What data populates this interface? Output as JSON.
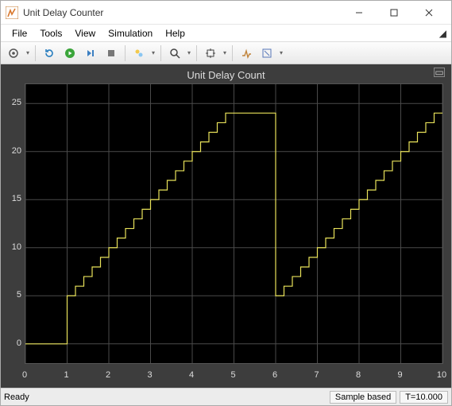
{
  "window": {
    "title": "Unit Delay Counter"
  },
  "menu": {
    "items": [
      "File",
      "Tools",
      "View",
      "Simulation",
      "Help"
    ]
  },
  "toolbar": {
    "buttons": [
      {
        "name": "config-gear",
        "caret": true
      },
      {
        "name": "restart"
      },
      {
        "name": "run"
      },
      {
        "name": "step-forward"
      },
      {
        "name": "stop"
      },
      {
        "name": "highlight",
        "caret": true
      },
      {
        "name": "zoom",
        "caret": true
      },
      {
        "name": "autoscale",
        "caret": true
      },
      {
        "name": "triggers"
      },
      {
        "name": "measurements",
        "caret": true
      }
    ]
  },
  "scope": {
    "title": "Unit Delay Count"
  },
  "status": {
    "ready": "Ready",
    "mode": "Sample based",
    "time": "T=10.000"
  },
  "chart_data": {
    "type": "line",
    "title": "Unit Delay Count",
    "xlabel": "",
    "ylabel": "",
    "xlim": [
      0,
      10
    ],
    "ylim": [
      -2,
      27
    ],
    "xticks": [
      0,
      1,
      2,
      3,
      4,
      5,
      6,
      7,
      8,
      9,
      10
    ],
    "yticks": [
      0,
      5,
      10,
      15,
      20,
      25
    ],
    "series": [
      {
        "name": "count",
        "color": "#e8e25a",
        "step": true,
        "x": [
          0,
          1,
          1.2,
          1.4,
          1.6,
          1.8,
          2,
          2.2,
          2.4,
          2.6,
          2.8,
          3,
          3.2,
          3.4,
          3.6,
          3.8,
          4,
          4.2,
          4.4,
          4.6,
          4.8,
          5,
          6,
          6.2,
          6.4,
          6.6,
          6.8,
          7,
          7.2,
          7.4,
          7.6,
          7.8,
          8,
          8.2,
          8.4,
          8.6,
          8.8,
          9,
          9.2,
          9.4,
          9.6,
          9.8,
          10
        ],
        "y": [
          0,
          5,
          6,
          7,
          8,
          9,
          10,
          11,
          12,
          13,
          14,
          15,
          16,
          17,
          18,
          19,
          20,
          21,
          22,
          23,
          24,
          24,
          5,
          6,
          7,
          8,
          9,
          10,
          11,
          12,
          13,
          14,
          15,
          16,
          17,
          18,
          19,
          20,
          21,
          22,
          23,
          24,
          24
        ]
      }
    ]
  }
}
